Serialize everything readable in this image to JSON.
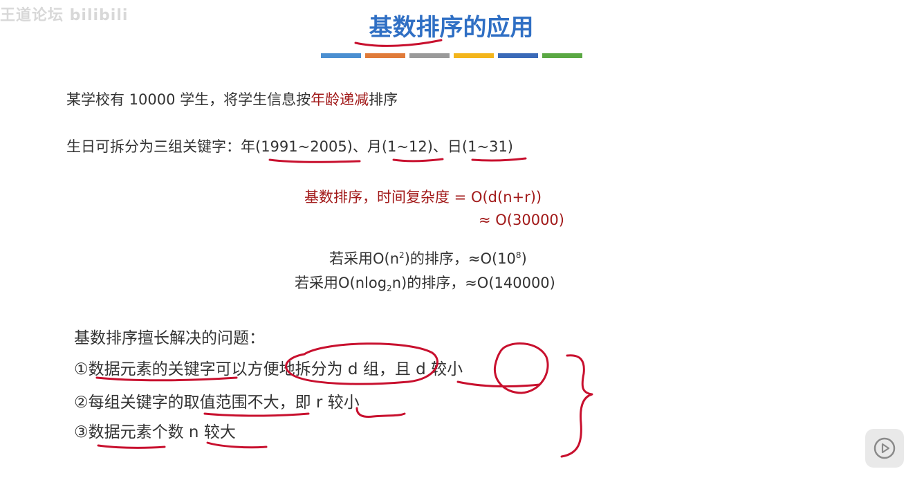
{
  "watermark": "王道论坛 bilibili",
  "title": "基数排序的应用",
  "title_bar_colors": [
    "#4b8fd1",
    "#e07b39",
    "#9a9a9a",
    "#f3b51c",
    "#3a6ab8",
    "#5aa843"
  ],
  "content": {
    "p1": {
      "before": "某学校有 10000 学生，将学生信息按",
      "highlight": "年龄递减",
      "after": "排序"
    },
    "p2": "生日可拆分为三组关键字：年(1991~2005)、月(1~12)、日(1~31)",
    "complexity": {
      "line1": "基数排序，时间复杂度 = O(d(n+r))",
      "line2": "≈ O(30000)",
      "alt1": {
        "before": "若采用O(n",
        "sup": "2",
        "mid": ")的排序，≈O(10",
        "sup2": "8",
        "after": ")"
      },
      "alt2": {
        "before": "若采用O(nlog",
        "sub": "2",
        "after": "n)的排序，≈O(140000)"
      }
    },
    "strengths": {
      "heading": "基数排序擅长解决的问题：",
      "items": [
        "①数据元素的关键字可以方便地拆分为 d 组，且 d 较小",
        "②每组关键字的取值范围不大，即 r 较小",
        "③数据元素个数 n 较大"
      ]
    }
  },
  "annotation_color": "#c8102e",
  "play_icon": "play-icon"
}
